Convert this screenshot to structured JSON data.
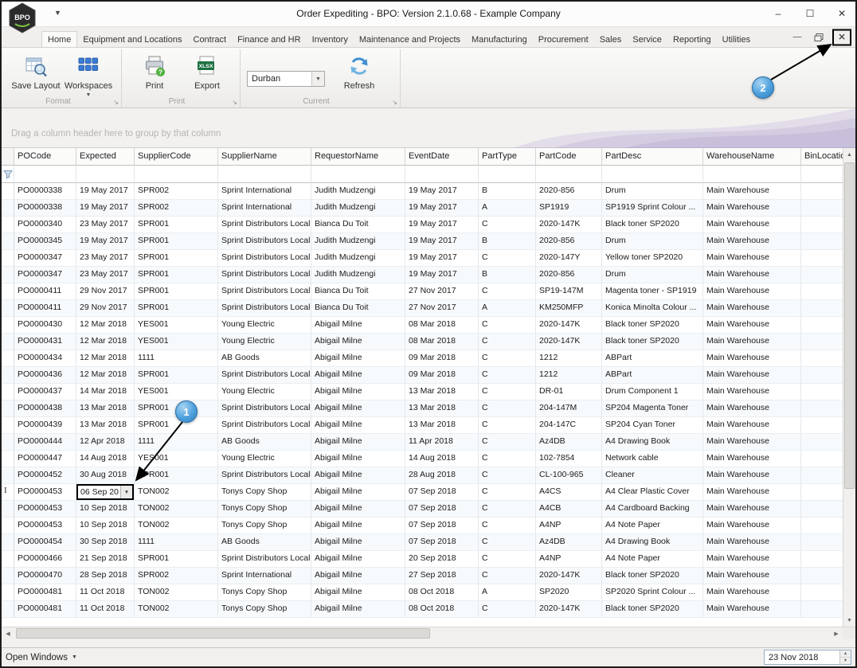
{
  "window": {
    "title": "Order Expediting - BPO: Version 2.1.0.68 - Example Company",
    "logo_text": "BPO",
    "controls": {
      "minimize": "–",
      "maximize": "☐",
      "close": "✕"
    }
  },
  "ribbon": {
    "tabs": [
      "Home",
      "Equipment and Locations",
      "Contract",
      "Finance and HR",
      "Inventory",
      "Maintenance and Projects",
      "Manufacturing",
      "Procurement",
      "Sales",
      "Service",
      "Reporting",
      "Utilities"
    ],
    "active_tab": "Home",
    "mdi": {
      "minimize": "—",
      "close": "✕"
    },
    "groups": {
      "format": {
        "title": "Format",
        "save_layout_label": "Save Layout",
        "workspaces_label": "Workspaces"
      },
      "print": {
        "title": "Print",
        "print_label": "Print",
        "export_label": "Export"
      },
      "current": {
        "title": "Current",
        "combo_value": "Durban",
        "refresh_label": "Refresh"
      }
    }
  },
  "grid": {
    "group_panel_text": "Drag a column header here to group by that column",
    "columns": [
      "POCode",
      "Expected",
      "SupplierCode",
      "SupplierName",
      "RequestorName",
      "EventDate",
      "PartType",
      "PartCode",
      "PartDesc",
      "WarehouseName",
      "BinLocationNa"
    ],
    "editing_row_index": 18,
    "editing_cell_value": "06 Sep 20",
    "rows": [
      [
        "PO0000338",
        "19 May 2017",
        "SPR002",
        "Sprint International",
        "Judith Mudzengi",
        "19 May 2017",
        "B",
        "2020-856",
        "Drum",
        "Main Warehouse",
        ""
      ],
      [
        "PO0000338",
        "19 May 2017",
        "SPR002",
        "Sprint International",
        "Judith Mudzengi",
        "19 May 2017",
        "A",
        "SP1919",
        "SP1919 Sprint Colour ...",
        "Main Warehouse",
        ""
      ],
      [
        "PO0000340",
        "23 May 2017",
        "SPR001",
        "Sprint Distributors Local",
        "Bianca Du Toit",
        "19 May 2017",
        "C",
        "2020-147K",
        "Black toner SP2020",
        "Main Warehouse",
        ""
      ],
      [
        "PO0000345",
        "19 May 2017",
        "SPR001",
        "Sprint Distributors Local",
        "Judith Mudzengi",
        "19 May 2017",
        "B",
        "2020-856",
        "Drum",
        "Main Warehouse",
        ""
      ],
      [
        "PO0000347",
        "23 May 2017",
        "SPR001",
        "Sprint Distributors Local",
        "Judith Mudzengi",
        "19 May 2017",
        "C",
        "2020-147Y",
        "Yellow toner SP2020",
        "Main Warehouse",
        ""
      ],
      [
        "PO0000347",
        "23 May 2017",
        "SPR001",
        "Sprint Distributors Local",
        "Judith Mudzengi",
        "19 May 2017",
        "B",
        "2020-856",
        "Drum",
        "Main Warehouse",
        ""
      ],
      [
        "PO0000411",
        "29 Nov 2017",
        "SPR001",
        "Sprint Distributors Local",
        "Bianca Du Toit",
        "27 Nov 2017",
        "C",
        "SP19-147M",
        "Magenta toner - SP1919",
        "Main Warehouse",
        ""
      ],
      [
        "PO0000411",
        "29 Nov 2017",
        "SPR001",
        "Sprint Distributors Local",
        "Bianca Du Toit",
        "27 Nov 2017",
        "A",
        "KM250MFP",
        "Konica Minolta Colour ...",
        "Main Warehouse",
        ""
      ],
      [
        "PO0000430",
        "12 Mar 2018",
        "YES001",
        "Young Electric",
        "Abigail Milne",
        "08 Mar 2018",
        "C",
        "2020-147K",
        "Black toner SP2020",
        "Main Warehouse",
        ""
      ],
      [
        "PO0000431",
        "12 Mar 2018",
        "YES001",
        "Young Electric",
        "Abigail Milne",
        "08 Mar 2018",
        "C",
        "2020-147K",
        "Black toner SP2020",
        "Main Warehouse",
        ""
      ],
      [
        "PO0000434",
        "12 Mar 2018",
        "1111",
        "AB Goods",
        "Abigail Milne",
        "09 Mar 2018",
        "C",
        "1212",
        "ABPart",
        "Main Warehouse",
        ""
      ],
      [
        "PO0000436",
        "12 Mar 2018",
        "SPR001",
        "Sprint Distributors Local",
        "Abigail Milne",
        "09 Mar 2018",
        "C",
        "1212",
        "ABPart",
        "Main Warehouse",
        ""
      ],
      [
        "PO0000437",
        "14 Mar 2018",
        "YES001",
        "Young Electric",
        "Abigail Milne",
        "13 Mar 2018",
        "C",
        "DR-01",
        "Drum Component 1",
        "Main Warehouse",
        ""
      ],
      [
        "PO0000438",
        "13 Mar 2018",
        "SPR001",
        "Sprint Distributors Local",
        "Abigail Milne",
        "13 Mar 2018",
        "C",
        "204-147M",
        "SP204 Magenta Toner",
        "Main Warehouse",
        ""
      ],
      [
        "PO0000439",
        "13 Mar 2018",
        "SPR001",
        "Sprint Distributors Local",
        "Abigail Milne",
        "13 Mar 2018",
        "C",
        "204-147C",
        "SP204 Cyan Toner",
        "Main Warehouse",
        ""
      ],
      [
        "PO0000444",
        "12 Apr 2018",
        "1111",
        "AB Goods",
        "Abigail Milne",
        "11 Apr 2018",
        "C",
        "Az4DB",
        "A4 Drawing Book",
        "Main Warehouse",
        ""
      ],
      [
        "PO0000447",
        "14 Aug 2018",
        "YES001",
        "Young Electric",
        "Abigail Milne",
        "14 Aug 2018",
        "C",
        "102-7854",
        "Network cable",
        "Main Warehouse",
        ""
      ],
      [
        "PO0000452",
        "30 Aug 2018",
        "SPR001",
        "Sprint Distributors Local",
        "Abigail Milne",
        "28 Aug 2018",
        "C",
        "CL-100-965",
        "Cleaner",
        "Main Warehouse",
        ""
      ],
      [
        "PO0000453",
        "06 Sep 20",
        "TON002",
        "Tonys Copy Shop",
        "Abigail Milne",
        "07 Sep 2018",
        "C",
        "A4CS",
        "A4 Clear Plastic Cover",
        "Main Warehouse",
        ""
      ],
      [
        "PO0000453",
        "10 Sep 2018",
        "TON002",
        "Tonys Copy Shop",
        "Abigail Milne",
        "07 Sep 2018",
        "C",
        "A4CB",
        "A4 Cardboard Backing",
        "Main Warehouse",
        ""
      ],
      [
        "PO0000453",
        "10 Sep 2018",
        "TON002",
        "Tonys Copy Shop",
        "Abigail Milne",
        "07 Sep 2018",
        "C",
        "A4NP",
        "A4 Note Paper",
        "Main Warehouse",
        ""
      ],
      [
        "PO0000454",
        "30 Sep 2018",
        "1111",
        "AB Goods",
        "Abigail Milne",
        "07 Sep 2018",
        "C",
        "Az4DB",
        "A4 Drawing Book",
        "Main Warehouse",
        ""
      ],
      [
        "PO0000466",
        "21 Sep 2018",
        "SPR001",
        "Sprint Distributors Local",
        "Abigail Milne",
        "20 Sep 2018",
        "C",
        "A4NP",
        "A4 Note Paper",
        "Main Warehouse",
        ""
      ],
      [
        "PO0000470",
        "28 Sep 2018",
        "SPR002",
        "Sprint International",
        "Abigail Milne",
        "27 Sep 2018",
        "C",
        "2020-147K",
        "Black toner SP2020",
        "Main Warehouse",
        ""
      ],
      [
        "PO0000481",
        "11 Oct 2018",
        "TON002",
        "Tonys Copy Shop",
        "Abigail Milne",
        "08 Oct 2018",
        "A",
        "SP2020",
        "SP2020 Sprint Colour ...",
        "Main Warehouse",
        ""
      ],
      [
        "PO0000481",
        "11 Oct 2018",
        "TON002",
        "Tonys Copy Shop",
        "Abigail Milne",
        "08 Oct 2018",
        "C",
        "2020-147K",
        "Black toner SP2020",
        "Main Warehouse",
        ""
      ]
    ]
  },
  "statusbar": {
    "open_windows_label": "Open Windows",
    "date_value": "23 Nov 2018"
  },
  "callouts": {
    "one": "1",
    "two": "2"
  },
  "icons": {
    "logo": "bpo-hexagon-icon",
    "save_layout": "grid-magnifier-icon",
    "workspaces": "blue-tiles-icon",
    "print": "printer-icon",
    "export": "xlsx-export-icon",
    "refresh": "refresh-arrows-icon",
    "filter": "funnel-icon",
    "mdi_restore": "restore-window-icon"
  },
  "colors": {
    "callout_blue": "#3d96d2",
    "annotation_black": "#000000",
    "export_green": "#1f7244",
    "workspaces_blue": "#3a7bd5"
  }
}
